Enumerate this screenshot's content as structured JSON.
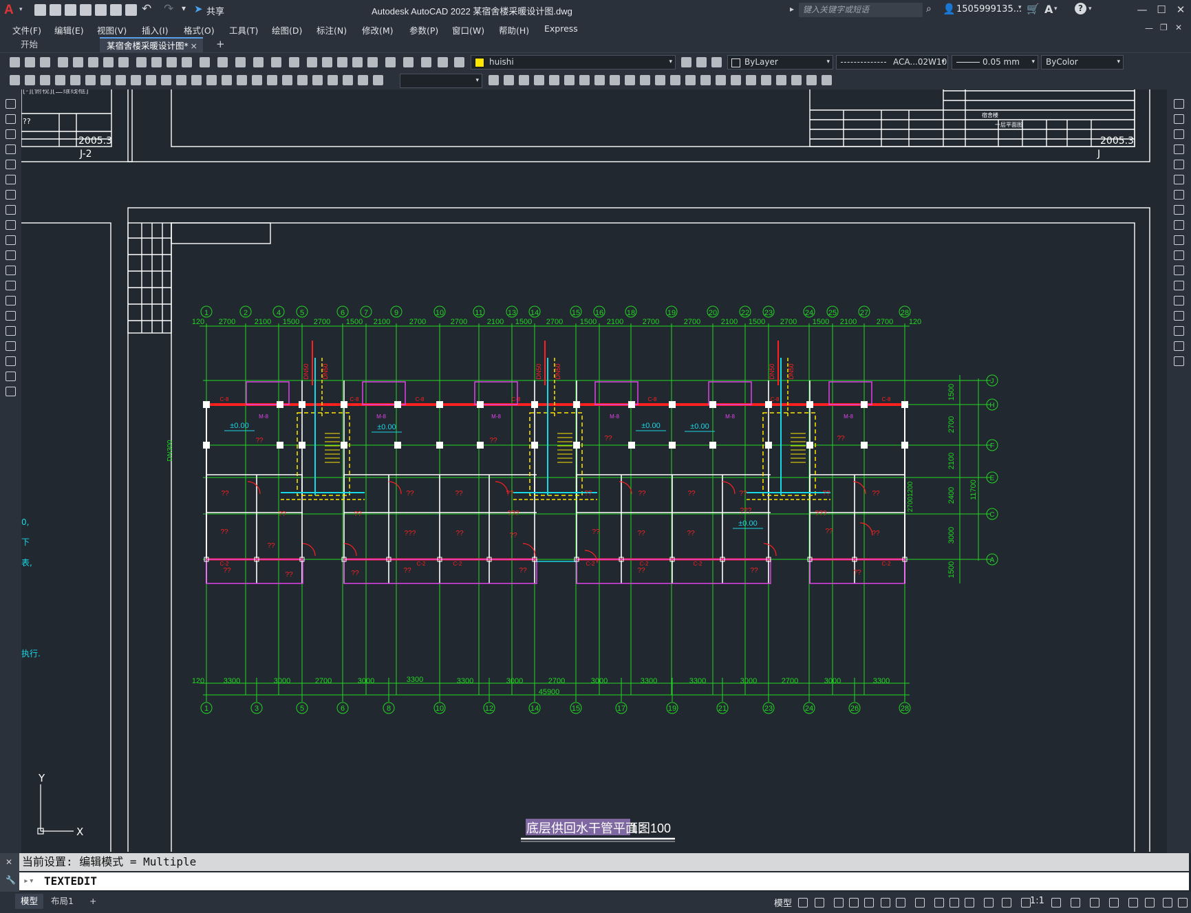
{
  "titlebar": {
    "app_logo": "A",
    "share_label": "共享",
    "title": "Autodesk AutoCAD 2022    某宿舍楼采暖设计图.dwg",
    "search_placeholder": "键入关键字或短语",
    "user": "1505999135...",
    "window_controls": [
      "—",
      "☐",
      "✕"
    ]
  },
  "menubar": {
    "items": [
      "文件(F)",
      "编辑(E)",
      "视图(V)",
      "插入(I)",
      "格式(O)",
      "工具(T)",
      "绘图(D)",
      "标注(N)",
      "修改(M)",
      "参数(P)",
      "窗口(W)",
      "帮助(H)",
      "Express"
    ]
  },
  "tabs": {
    "start": "开始",
    "drawing": "某宿舍楼采暖设计图*",
    "close": "×",
    "add": "+"
  },
  "toolbar": {
    "layer": "huishi",
    "color": "ByLayer",
    "linetype": "ACA...02W10",
    "lineweight": "0.05 mm",
    "plotstyle": "ByColor",
    "textstyle": ""
  },
  "drawing": {
    "title": "底层供回水干管平面图",
    "scale": "1：100",
    "title_block_left": {
      "date": "2005.3",
      "sheet": "J-2",
      "qq": "??",
      "viewport_label": "[-][俯视][二维线框]"
    },
    "title_block_right": {
      "date": "2005.3",
      "sheet": "J",
      "row1": "宿舍楼",
      "row2": "一层平面图"
    },
    "top_axes": [
      "1",
      "2",
      "4",
      "5",
      "6",
      "7",
      "9",
      "10",
      "11",
      "13",
      "14",
      "15",
      "16",
      "18",
      "19",
      "20",
      "22",
      "23",
      "24",
      "25",
      "27",
      "28"
    ],
    "top_dims": [
      "120",
      "2700",
      "2100",
      "1500",
      "2700",
      "1500",
      "2100",
      "2700",
      "2700",
      "2100",
      "1500",
      "2700",
      "1500",
      "2100",
      "2700",
      "2700",
      "2100",
      "1500",
      "2700",
      "1500",
      "2100",
      "2700",
      "120"
    ],
    "bottom_axes": [
      "1",
      "3",
      "5",
      "6",
      "8",
      "10",
      "12",
      "14",
      "15",
      "17",
      "19",
      "21",
      "23",
      "24",
      "26",
      "28"
    ],
    "bottom_dims": [
      "120",
      "3300",
      "3000",
      "2700",
      "3000",
      "3300",
      "3300",
      "3000",
      "2700",
      "3000",
      "3300",
      "3300",
      "3000",
      "2700",
      "3000",
      "3300"
    ],
    "total_dim": "45900",
    "right_axes": [
      "J",
      "H",
      "F",
      "E",
      "C",
      "A"
    ],
    "right_dims": [
      "1500",
      "2700",
      "2100",
      "2400",
      "3000",
      "1500"
    ],
    "right_total": "11700",
    "right_secondary": [
      "2700",
      "1200"
    ],
    "pipe_label": "DN300",
    "riser_labels": [
      "DN50",
      "DN50"
    ],
    "room_label": "??",
    "room_label_alt": "???",
    "elevation": "±0.00",
    "door_label": "M-8",
    "window_label": "C-8",
    "window_label_2": "C-2",
    "left_partial_text": [
      "0,",
      "下",
      "表,",
      "执行."
    ]
  },
  "ucs": {
    "x": "X",
    "y": "Y"
  },
  "command": {
    "history": "当前设置: 编辑模式 = Multiple",
    "input": "TEXTEDIT"
  },
  "status": {
    "model_tab": "模型",
    "layout_tab": "布局1",
    "add_tab": "+",
    "model_label": "模型",
    "scale": "1:1"
  },
  "colors": {
    "axis": "#22d722",
    "wall": "#ffffff",
    "supply": "#ff2020",
    "riser": "#19d9e6",
    "return": "#ffe600",
    "fixture": "#e043e8",
    "background": "#212830"
  }
}
